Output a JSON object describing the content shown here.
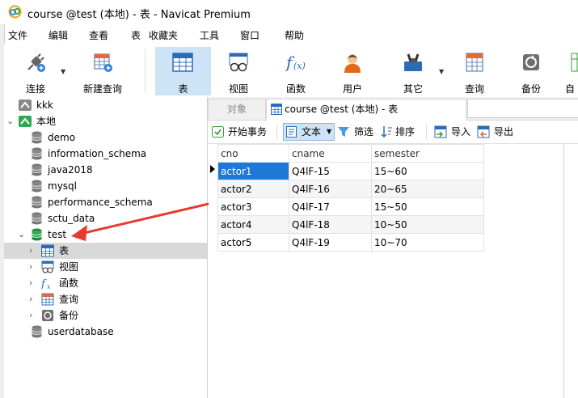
{
  "window": {
    "title": "course @test (本地) - 表 - Navicat Premium"
  },
  "menu": [
    "文件",
    "编辑",
    "查看",
    "表",
    "收藏夹",
    "工具",
    "窗口",
    "帮助"
  ],
  "toolbar": {
    "items": [
      {
        "label": "连接",
        "icon": "connection-icon"
      },
      {
        "label": "新建查询",
        "icon": "new-query-icon"
      },
      {
        "label": "表",
        "icon": "table-icon",
        "active": true
      },
      {
        "label": "视图",
        "icon": "view-icon"
      },
      {
        "label": "函数",
        "icon": "function-icon"
      },
      {
        "label": "用户",
        "icon": "user-icon"
      },
      {
        "label": "其它",
        "icon": "other-icon"
      },
      {
        "label": "查询",
        "icon": "query-icon"
      },
      {
        "label": "备份",
        "icon": "backup-icon"
      },
      {
        "label": "自",
        "icon": "auto-icon"
      }
    ]
  },
  "tree": {
    "kkk": "kkk",
    "local": "本地",
    "databases": [
      "demo",
      "information_schema",
      "java2018",
      "mysql",
      "performance_schema",
      "sctu_data"
    ],
    "test": "test",
    "test_children": [
      "表",
      "视图",
      "函数",
      "查询",
      "备份"
    ],
    "userdatabase": "userdatabase"
  },
  "tabs": {
    "objects": "对象",
    "active": "course @test (本地) - 表"
  },
  "subtoolbar": {
    "begin_transaction": "开始事务",
    "text": "文本",
    "filter": "筛选",
    "sort": "排序",
    "import": "导入",
    "export": "导出"
  },
  "grid": {
    "columns": [
      "cno",
      "cname",
      "semester"
    ],
    "rows": [
      [
        "actor1",
        "Q4lF-15",
        "15~60"
      ],
      [
        "actor2",
        "Q4lF-16",
        "20~65"
      ],
      [
        "actor3",
        "Q4lF-17",
        "15~50"
      ],
      [
        "actor4",
        "Q4lF-18",
        "10~50"
      ],
      [
        "actor5",
        "Q4lF-19",
        "10~70"
      ]
    ]
  },
  "colors": {
    "selection": "#1e78d7",
    "active_toolbar": "#cde4f7",
    "annotation_arrow": "#e8392e"
  }
}
